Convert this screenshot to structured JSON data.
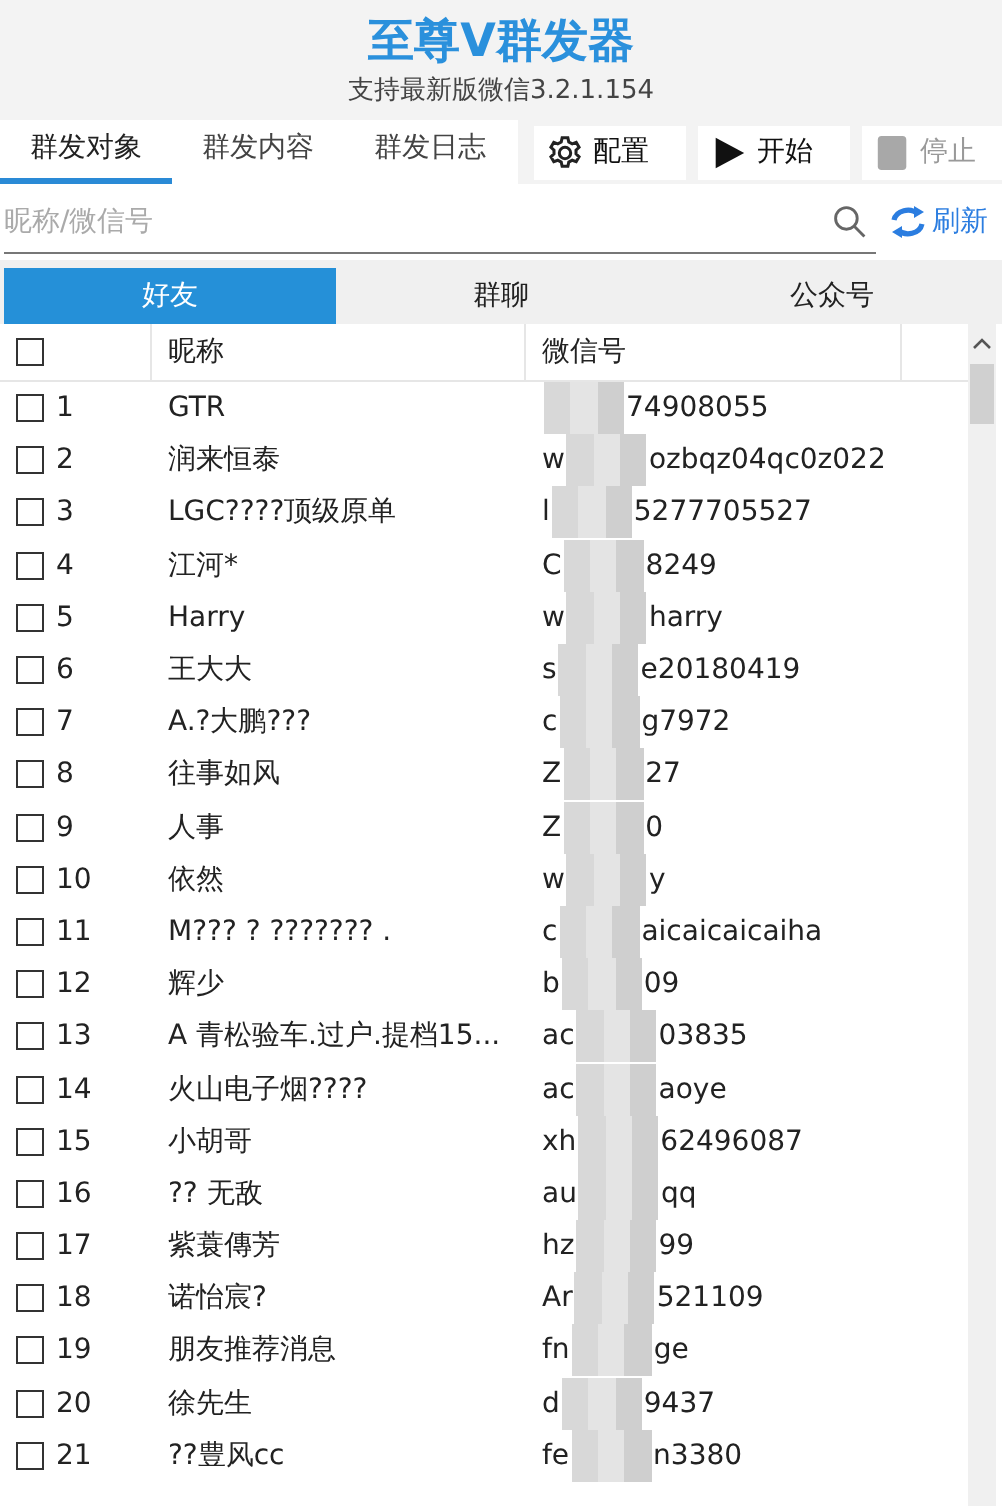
{
  "app": {
    "title": "至尊V群发器",
    "subtitle": "支持最新版微信3.2.1.154"
  },
  "tabs": [
    {
      "label": "群发对象",
      "selected": true
    },
    {
      "label": "群发内容",
      "selected": false
    },
    {
      "label": "群发日志",
      "selected": false
    }
  ],
  "toolbar": [
    {
      "kind": "settings",
      "label": "配置",
      "disabled": false
    },
    {
      "kind": "start",
      "label": "开始",
      "disabled": false
    },
    {
      "kind": "stop",
      "label": "停止",
      "disabled": true
    }
  ],
  "search": {
    "placeholder": "昵称/微信号",
    "refresh": "刷新"
  },
  "segments": [
    {
      "label": "好友",
      "selected": true
    },
    {
      "label": "群聊",
      "selected": false
    },
    {
      "label": "公众号",
      "selected": false
    }
  ],
  "table": {
    "header_checked": false,
    "columns": [
      "昵称",
      "微信号"
    ],
    "rows": [
      {
        "no": "1",
        "name": "GTR",
        "id_end": "74908055",
        "checked": false
      },
      {
        "no": "2",
        "name": "润来恒泰",
        "id_start": "w",
        "id_end": "ozbqz04qc0z022",
        "checked": false
      },
      {
        "no": "3",
        "name": "LGC????顶级原单",
        "id_start": "l",
        "id_end": "5277705527",
        "checked": false
      },
      {
        "no": "4",
        "name": "江河*",
        "id_start": "C",
        "id_end": "8249",
        "checked": false
      },
      {
        "no": "5",
        "name": "Harry",
        "id_start": "w",
        "id_end": "harry",
        "checked": false
      },
      {
        "no": "6",
        "name": "王大大",
        "id_start": "s",
        "id_end": "e20180419",
        "checked": false
      },
      {
        "no": "7",
        "name": "A.?大鹏???",
        "id_start": "c",
        "id_end": "g7972",
        "checked": false
      },
      {
        "no": "8",
        "name": "往事如风",
        "id_start": "Z",
        "id_end": "27",
        "checked": false
      },
      {
        "no": "9",
        "name": "人事",
        "id_start": "Z",
        "id_end": "0",
        "checked": false
      },
      {
        "no": "10",
        "name": "依然",
        "id_start": "w",
        "id_end": "y",
        "checked": false
      },
      {
        "no": "11",
        "name": "M??? ? ??????? .",
        "id_start": "c",
        "id_end": "aicaicaicaiha",
        "checked": false
      },
      {
        "no": "12",
        "name": "辉少",
        "id_start": "b",
        "id_end": "09",
        "checked": false
      },
      {
        "no": "13",
        "name": "A 青松验车.过户.提档15...",
        "id_start": "ac",
        "id_end": "03835",
        "checked": false
      },
      {
        "no": "14",
        "name": "火山电子烟????",
        "id_start": "ac",
        "id_end": "aoye",
        "checked": false
      },
      {
        "no": "15",
        "name": "小胡哥",
        "id_start": "xh",
        "id_end": "62496087",
        "checked": false
      },
      {
        "no": "16",
        "name": "?? 无敌",
        "id_start": "au",
        "id_end": "qq",
        "checked": false
      },
      {
        "no": "17",
        "name": "紫蓑傳芳",
        "id_start": "hz",
        "id_end": "99",
        "checked": false
      },
      {
        "no": "18",
        "name": "诺怡宸?",
        "id_start": "Ar",
        "id_end": "521109",
        "checked": false
      },
      {
        "no": "19",
        "name": "朋友推荐消息",
        "id_start": "fn",
        "id_end": "ge",
        "checked": false
      },
      {
        "no": "20",
        "name": "徐先生",
        "id_start": "d",
        "id_end": "9437",
        "checked": false
      },
      {
        "no": "21",
        "name": "??豊风cc",
        "id_start": "fe",
        "id_end": "n3380",
        "checked": false
      }
    ]
  }
}
